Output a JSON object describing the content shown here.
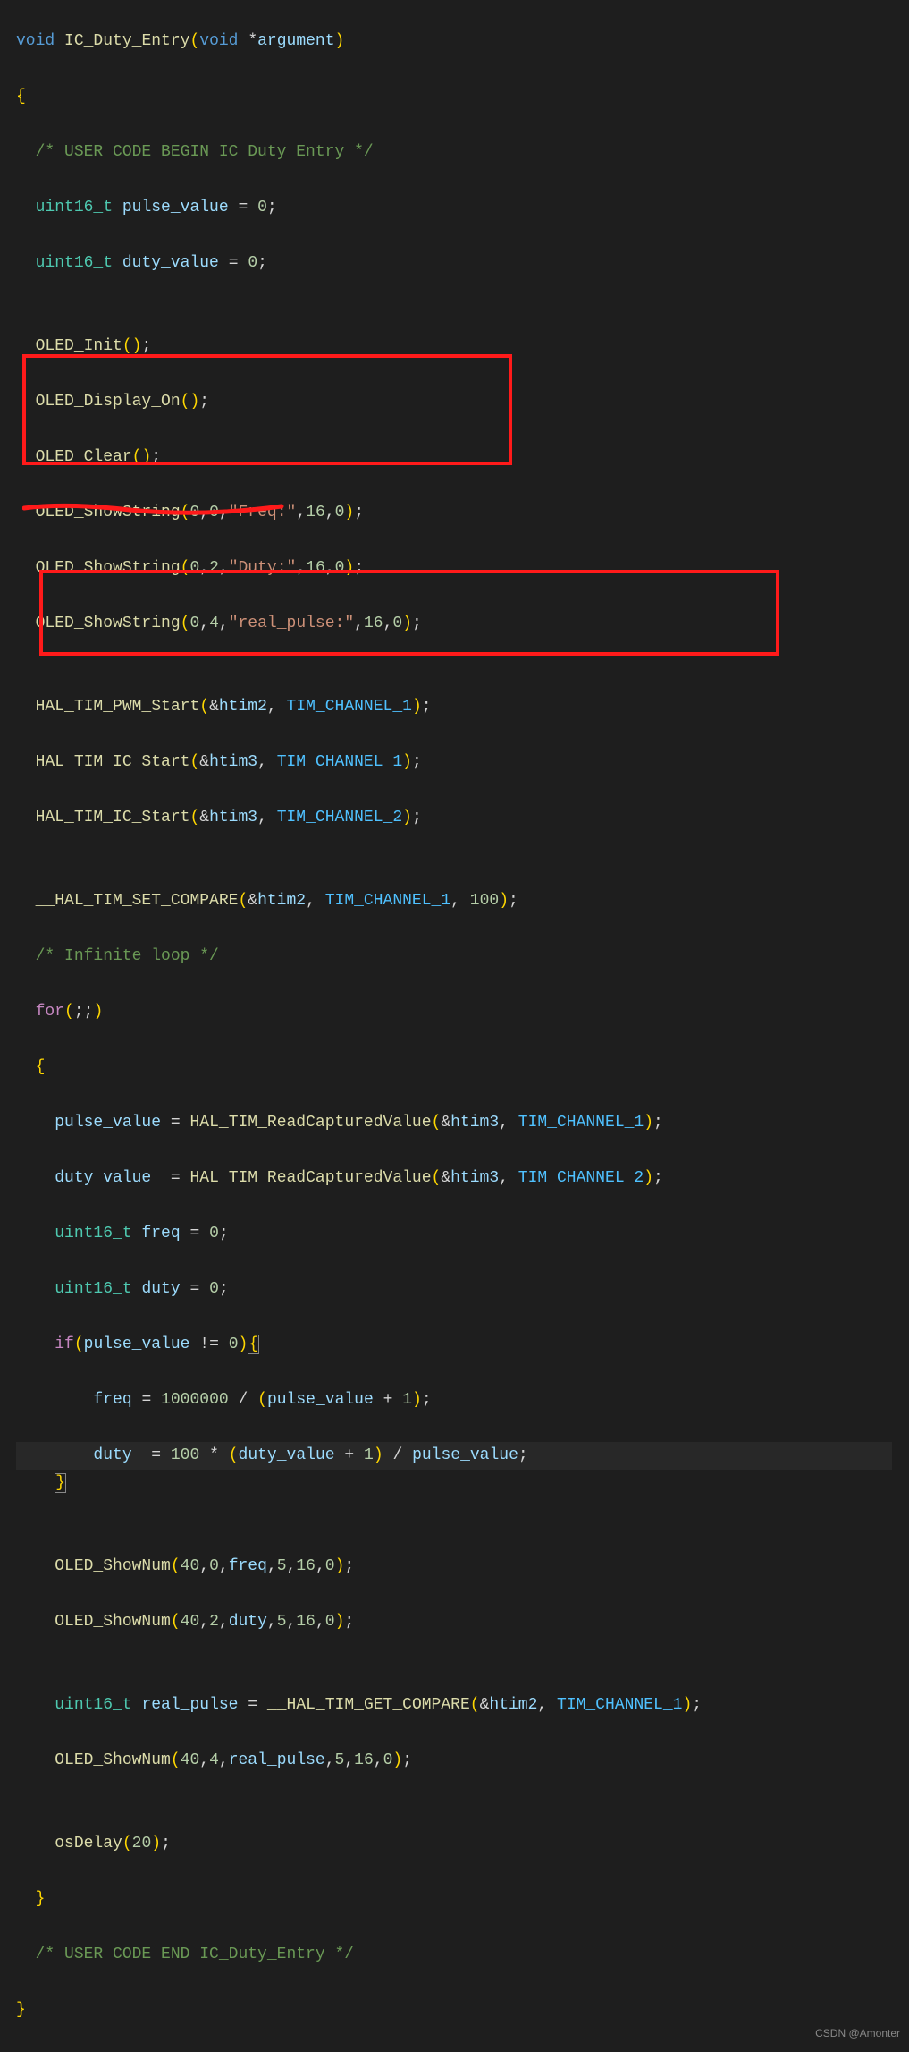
{
  "code": {
    "l1_void": "void",
    "l1_fn": "IC_Duty_Entry",
    "l1_argt": "void",
    "l1_argn": "argument",
    "l2_brace": "{",
    "l3_cm": "/* USER CODE BEGIN IC_Duty_Entry */",
    "l4_type": "uint16_t",
    "l4_var": "pulse_value",
    "l4_val": "0",
    "l5_type": "uint16_t",
    "l5_var": "duty_value",
    "l5_val": "0",
    "l7_fn": "OLED_Init",
    "l8_fn": "OLED_Display_On",
    "l9_fn": "OLED_Clear",
    "l10_fn": "OLED_ShowString",
    "l10_a1": "0",
    "l10_a2": "0",
    "l10_s": "\"Freq:\"",
    "l10_a3": "16",
    "l10_a4": "0",
    "l11_fn": "OLED_ShowString",
    "l11_a1": "0",
    "l11_a2": "2",
    "l11_s": "\"Duty:\"",
    "l11_a3": "16",
    "l11_a4": "0",
    "l12_fn": "OLED_ShowString",
    "l12_a1": "0",
    "l12_a2": "4",
    "l12_s": "\"real_pulse:\"",
    "l12_a3": "16",
    "l12_a4": "0",
    "l14_fn": "HAL_TIM_PWM_Start",
    "l14_a1": "htim2",
    "l14_a2": "TIM_CHANNEL_1",
    "l15_fn": "HAL_TIM_IC_Start",
    "l15_a1": "htim3",
    "l15_a2": "TIM_CHANNEL_1",
    "l16_fn": "HAL_TIM_IC_Start",
    "l16_a1": "htim3",
    "l16_a2": "TIM_CHANNEL_2",
    "l18_fn": "__HAL_TIM_SET_COMPARE",
    "l18_a1": "htim2",
    "l18_a2": "TIM_CHANNEL_1",
    "l18_a3": "100",
    "l19_cm": "/* Infinite loop */",
    "l20_for": "for",
    "l22_var": "pulse_value",
    "l22_fn": "HAL_TIM_ReadCapturedValue",
    "l22_a1": "htim3",
    "l22_a2": "TIM_CHANNEL_1",
    "l23_var": "duty_value",
    "l23_fn": "HAL_TIM_ReadCapturedValue",
    "l23_a1": "htim3",
    "l23_a2": "TIM_CHANNEL_2",
    "l24_type": "uint16_t",
    "l24_var": "freq",
    "l24_val": "0",
    "l25_type": "uint16_t",
    "l25_var": "duty",
    "l25_val": "0",
    "l26_if": "if",
    "l26_var": "pulse_value",
    "l26_val": "0",
    "l27_var": "freq",
    "l27_v1": "1000000",
    "l27_v2": "pulse_value",
    "l27_v3": "1",
    "l28_var": "duty",
    "l28_v1": "100",
    "l28_v2": "duty_value",
    "l28_v3": "1",
    "l28_v4": "pulse_value",
    "l31_fn": "OLED_ShowNum",
    "l31_a1": "40",
    "l31_a2": "0",
    "l31_a3": "freq",
    "l31_a4": "5",
    "l31_a5": "16",
    "l31_a6": "0",
    "l32_fn": "OLED_ShowNum",
    "l32_a1": "40",
    "l32_a2": "2",
    "l32_a3": "duty",
    "l32_a4": "5",
    "l32_a5": "16",
    "l32_a6": "0",
    "l34_type": "uint16_t",
    "l34_var": "real_pulse",
    "l34_fn": "__HAL_TIM_GET_COMPARE",
    "l34_a1": "htim2",
    "l34_a2": "TIM_CHANNEL_1",
    "l35_fn": "OLED_ShowNum",
    "l35_a1": "40",
    "l35_a2": "4",
    "l35_a3": "real_pulse",
    "l35_a4": "5",
    "l35_a5": "16",
    "l35_a6": "0",
    "l37_fn": "osDelay",
    "l37_a1": "20",
    "l39_cm": "/* USER CODE END IC_Duty_Entry */"
  },
  "watermark": "CSDN @Amonter"
}
